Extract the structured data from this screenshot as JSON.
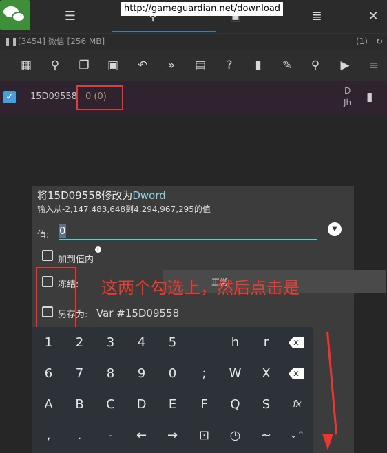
{
  "top_bar": {
    "url_banner": "http://gameguardian.net/download"
  },
  "status_bar": {
    "process": "[3454] 微信 [256 MB]",
    "count": "(1)"
  },
  "result_row": {
    "address": "15D09558",
    "value": "0 (0)",
    "type_line1": "D",
    "type_line2": "Jh"
  },
  "dialog": {
    "title_prefix": "将15D09558修改为",
    "title_type": "Dword",
    "subtitle": "输入从-2,147,483,648到4,294,967,295的值",
    "value_label": "值:",
    "value": "0",
    "add_to_value_label": "加到值内",
    "freeze_label": "冻结:",
    "freeze_mode": "正常",
    "save_as_label": "另存为:",
    "save_as_value": "Var #15D09558"
  },
  "annotation": {
    "instruction": "这两个勾选上，然后点击是"
  },
  "keyboard": {
    "row1": [
      "1",
      "2",
      "3",
      "4",
      "5",
      "h",
      "r"
    ],
    "row2": [
      "6",
      "7",
      "8",
      "9",
      "0",
      ";",
      "W",
      "X"
    ],
    "row3": [
      "A",
      "B",
      "C",
      "D",
      "E",
      "F",
      "Q",
      "S",
      "fx"
    ],
    "row4": [
      ",",
      ".",
      "-",
      "←",
      "→",
      "⊡",
      "◷",
      "~",
      "⌄⌃"
    ]
  },
  "colors": {
    "accent": "#8fd3e2",
    "annotation_red": "#e53935",
    "selection_blue": "#4a9ed8"
  }
}
